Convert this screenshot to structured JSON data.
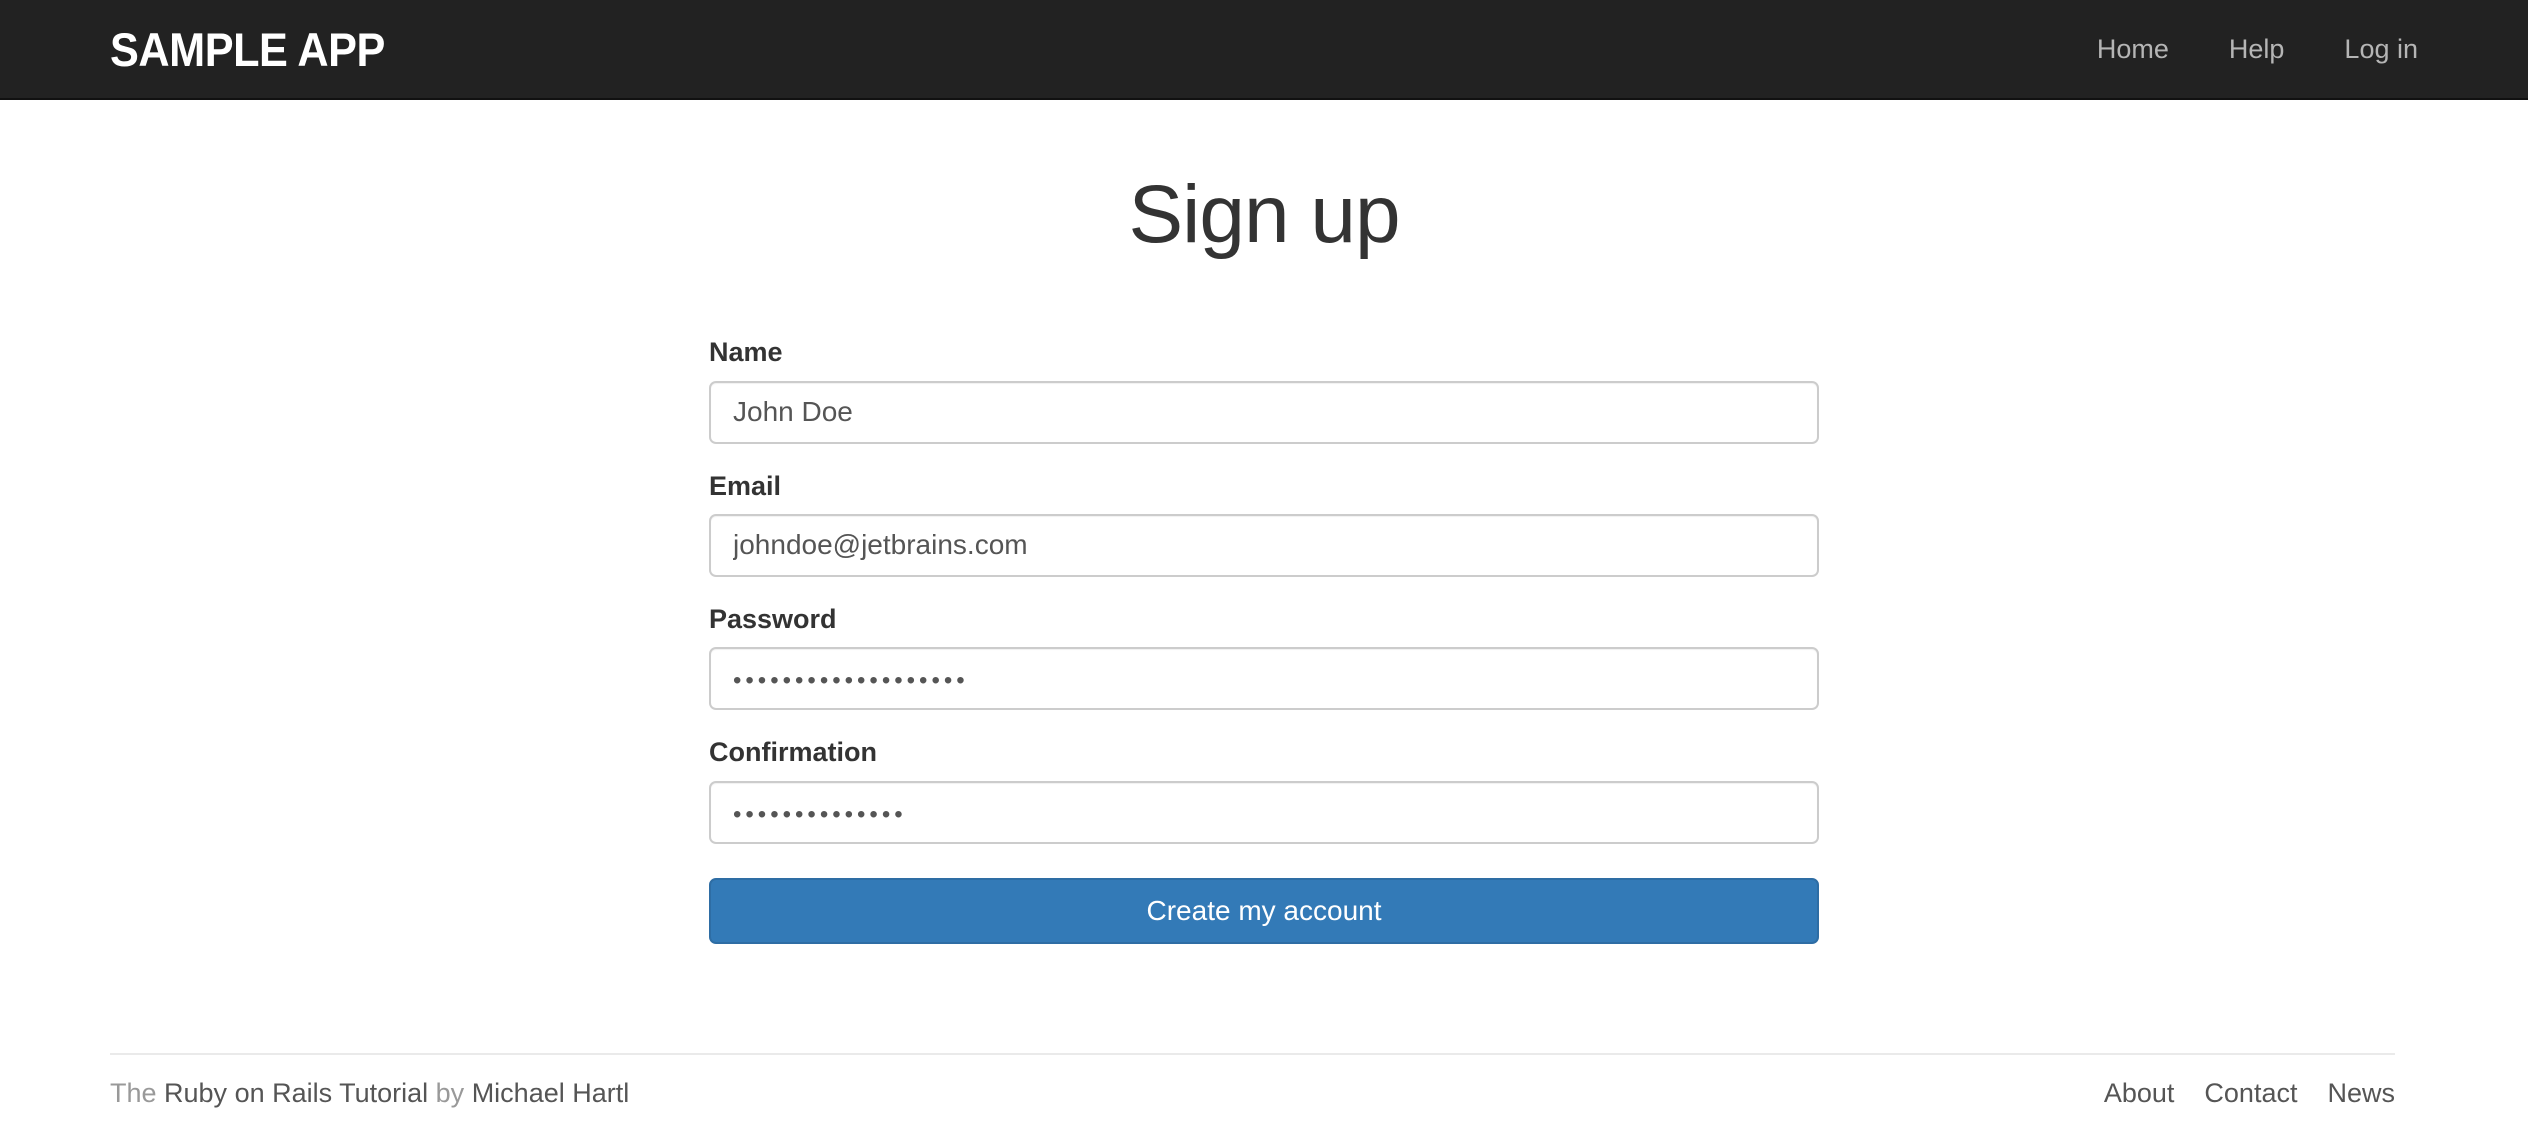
{
  "header": {
    "logo": "SAMPLE APP",
    "nav": [
      {
        "label": "Home"
      },
      {
        "label": "Help"
      },
      {
        "label": "Log in"
      }
    ]
  },
  "main": {
    "title": "Sign up",
    "form": {
      "fields": [
        {
          "label": "Name",
          "type": "text",
          "value": "John Doe",
          "placeholder": ""
        },
        {
          "label": "Email",
          "type": "email",
          "value": "johndoe@jetbrains.com",
          "placeholder": ""
        },
        {
          "label": "Password",
          "type": "password",
          "value": "•••••••••••••••••••",
          "placeholder": ""
        },
        {
          "label": "Confirmation",
          "type": "password",
          "value": "••••••••••••••",
          "placeholder": ""
        }
      ],
      "submit_label": "Create my account"
    }
  },
  "footer": {
    "text_prefix": "The ",
    "tutorial_link": "Ruby on Rails Tutorial",
    "text_middle": " by ",
    "author_link": "Michael Hartl",
    "links": [
      {
        "label": "About"
      },
      {
        "label": "Contact"
      },
      {
        "label": "News"
      }
    ]
  },
  "colors": {
    "navbar_bg": "#222222",
    "primary": "#337ab7",
    "primary_border": "#2e6da4",
    "text": "#333333",
    "muted": "#999999",
    "border": "#cccccc"
  }
}
